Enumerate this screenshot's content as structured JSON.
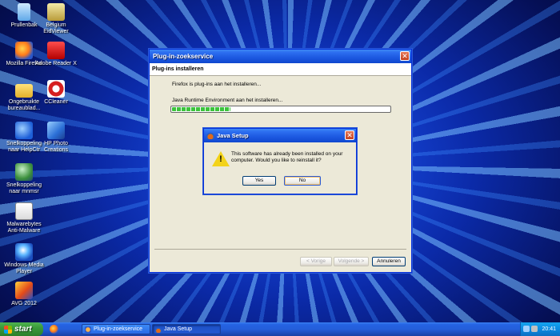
{
  "desktop": {
    "icons": [
      {
        "label": "Prullenbak",
        "icon": "recycle-bin-icon"
      },
      {
        "label": "Belgium EidViewer",
        "icon": "belgium-eid-icon"
      },
      {
        "label": "Mozilla Firefox",
        "icon": "firefox-icon"
      },
      {
        "label": "Adobe Reader X",
        "icon": "adobe-reader-icon"
      },
      {
        "label": "Ongebruikte bureaublad...",
        "icon": "folder-icon"
      },
      {
        "label": "CCleaner",
        "icon": "ccleaner-icon"
      },
      {
        "label": "Snelkoppeling naar HelpCtr",
        "icon": "help-center-icon"
      },
      {
        "label": "HP Photo Creations",
        "icon": "hp-photo-icon"
      },
      {
        "label": "Snelkoppeling naar mnmsr",
        "icon": "meeting-icon"
      },
      {
        "label": "Malwarebytes Anti-Malware",
        "icon": "malwarebytes-icon"
      },
      {
        "label": "Windows Media Player",
        "icon": "media-player-icon"
      },
      {
        "label": "AVG 2012",
        "icon": "avg-icon"
      }
    ]
  },
  "plugin_window": {
    "title": "Plug-in-zoekservice",
    "header": "Plug-ins installeren",
    "status_line": "Firefox is plug-ins aan het installeren...",
    "plugin_line": "Java Runtime Environment aan het installeren...",
    "progress_fraction": 0.27,
    "buttons": {
      "back": "< Vorige",
      "next": "Volgende >",
      "cancel": "Annuleren"
    }
  },
  "java_dialog": {
    "title": "Java Setup",
    "message": "This software has already been installed on your computer.  Would you like to reinstall it?",
    "yes_label": "Yes",
    "no_label": "No"
  },
  "taskbar": {
    "start_label": "start",
    "tasks": [
      {
        "label": "Plug-in-zoekservice"
      },
      {
        "label": "Java Setup"
      }
    ],
    "clock": "20:41"
  },
  "colors": {
    "xp_title_blue": "#1c58e0",
    "progress_green": "#3cc43c",
    "start_green": "#3a9a3a",
    "close_red": "#c4401e"
  }
}
